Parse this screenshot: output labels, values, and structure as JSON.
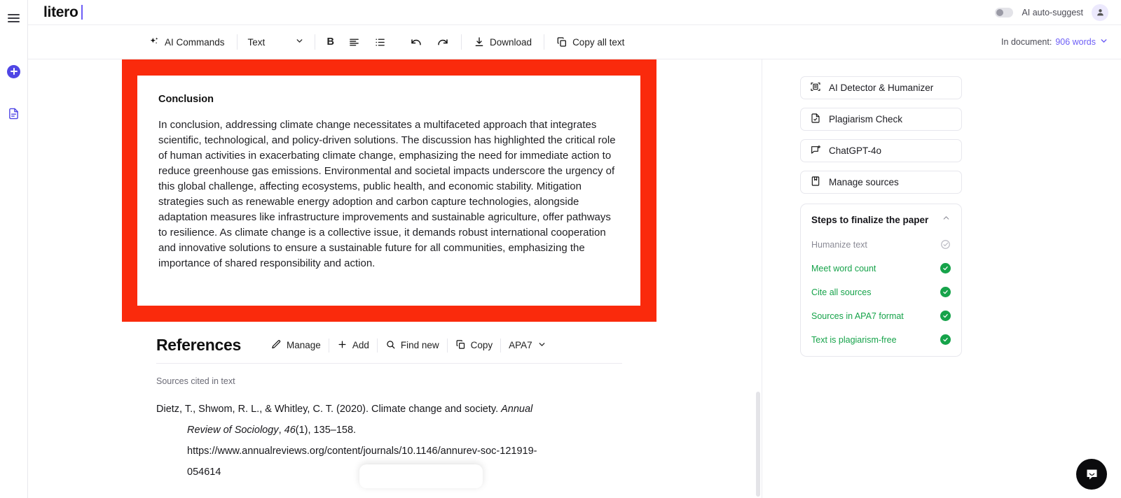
{
  "brand": {
    "name": "litero"
  },
  "header": {
    "ai_suggest_label": "AI auto-suggest",
    "toggle_state": "off",
    "avatar_icon": "user-avatar-icon"
  },
  "toolbar": {
    "ai_commands_label": "AI Commands",
    "style_select_value": "Text",
    "bold_label": "B",
    "align_icon": "align-left-icon",
    "list_icon": "bullet-list-icon",
    "undo_icon": "undo-icon",
    "redo_icon": "redo-icon",
    "download_label": "Download",
    "copy_all_label": "Copy all text",
    "in_document_label": "In document:",
    "word_count": "906 words",
    "word_count_color": "#6d5ef6"
  },
  "document": {
    "highlight_color": "#fa2a0c",
    "heading": "Conclusion",
    "paragraph": "In conclusion, addressing climate change necessitates a multifaceted approach that integrates scientific, technological, and policy-driven solutions. The discussion has highlighted the critical role of human activities in exacerbating climate change, emphasizing the need for immediate action to reduce greenhouse gas emissions. Environmental and societal impacts underscore the urgency of this global challenge, affecting ecosystems, public health, and economic stability. Mitigation strategies such as renewable energy adoption and carbon capture technologies, alongside adaptation measures like infrastructure improvements and sustainable agriculture, offer pathways to resilience. As climate change is a collective issue, it demands robust international cooperation and innovative solutions to ensure a sustainable future for all communities, emphasizing the importance of shared responsibility and action."
  },
  "references": {
    "title": "References",
    "actions": [
      {
        "label": "Manage",
        "icon": "pencil-icon"
      },
      {
        "label": "Add",
        "icon": "plus-icon"
      },
      {
        "label": "Find new",
        "icon": "search-icon"
      },
      {
        "label": "Copy",
        "icon": "copy-icon"
      }
    ],
    "style_value": "APA7",
    "subtitle": "Sources cited in text",
    "entry": {
      "line1_pre": "Dietz, T., Shwom, R. L., & Whitley, C. T. (2020). Climate change and society. ",
      "line1_italic": "Annual",
      "line2_italic": "Review of Sociology",
      "line2_post": ", ",
      "line2_vol_italic": "46",
      "line2_rest": "(1), 135–158.",
      "line3": "https://www.annualreviews.org/content/journals/10.1146/annurev-soc-121919-",
      "line4": "054614"
    }
  },
  "side_panel": {
    "tools": [
      {
        "label": "AI Detector & Humanizer",
        "icon": "ai-detector-icon"
      },
      {
        "label": "Plagiarism Check",
        "icon": "document-check-icon"
      },
      {
        "label": "ChatGPT-4o",
        "icon": "chat-plus-icon"
      },
      {
        "label": "Manage sources",
        "icon": "book-icon"
      }
    ],
    "steps": {
      "title": "Steps to finalize the paper",
      "collapse_icon": "chevron-up-icon",
      "done_color": "#16a34a",
      "pending_color": "#8b8b96",
      "items": [
        {
          "label": "Humanize text",
          "status": "pending"
        },
        {
          "label": "Meet word count",
          "status": "done"
        },
        {
          "label": "Cite all sources",
          "status": "done"
        },
        {
          "label": "Sources in APA7 format",
          "status": "done"
        },
        {
          "label": "Text is plagiarism-free",
          "status": "done"
        }
      ]
    }
  },
  "rail": {
    "menu_icon": "hamburger-menu-icon",
    "new_icon": "add-new-icon",
    "doc_icon": "document-icon"
  },
  "chat_widget": {
    "icon": "intercom-chat-icon"
  }
}
